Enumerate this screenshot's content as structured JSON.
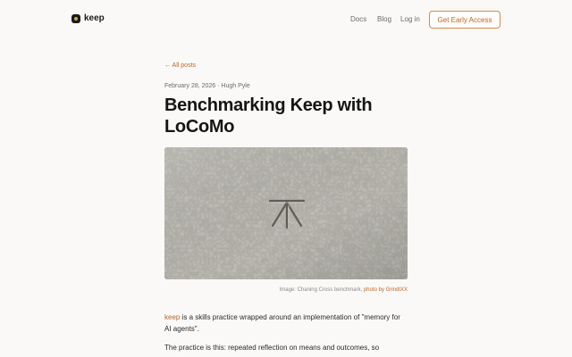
{
  "nav": {
    "brand": "keep",
    "links": [
      "Docs",
      "Blog",
      "Log in"
    ],
    "cta": "Get Early Access"
  },
  "post": {
    "back_link": "← All posts",
    "meta": "February 28, 2026 · Hugh Pyle",
    "title": "Benchmarking Keep with LoCoMo",
    "caption_prefix": "Image: Chaning Cross benchmark, ",
    "caption_link": "photo by GrindtXX",
    "p1_link": "keep",
    "p1_rest": " is a skills practice wrapped around an implementation of \"memory for AI agents\".",
    "p2": "The practice is this: repeated reflection on means and outcomes, so"
  }
}
